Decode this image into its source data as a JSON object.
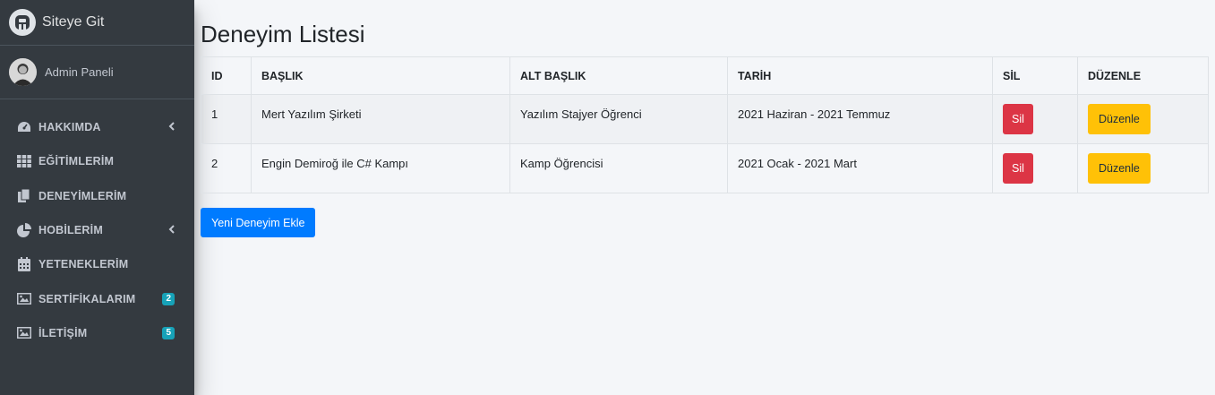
{
  "brand": {
    "name": "Siteye Git",
    "icon": "logo-icon"
  },
  "user": {
    "name": "Admin Paneli"
  },
  "sidebar": {
    "items": [
      {
        "label": "HAKKIMDA",
        "icon": "dashboard-icon",
        "chevron": true
      },
      {
        "label": "EĞİTİMLERİM",
        "icon": "grid-icon",
        "chevron": false
      },
      {
        "label": "DENEYİMLERİM",
        "icon": "copy-icon",
        "chevron": false
      },
      {
        "label": "HOBİLERİM",
        "icon": "pie-chart-icon",
        "chevron": true
      },
      {
        "label": "YETENEKLERİM",
        "icon": "calendar-icon",
        "chevron": false
      },
      {
        "label": "SERTİFİKALARIM",
        "icon": "image-icon",
        "badge": "2"
      },
      {
        "label": "İLETİŞİM",
        "icon": "image-icon",
        "badge": "5"
      }
    ]
  },
  "main": {
    "title": "Deneyim Listesi",
    "table": {
      "headers": [
        "ID",
        "BAŞLIK",
        "ALT BAŞLIK",
        "TARİH",
        "SİL",
        "DÜZENLE"
      ],
      "rows": [
        {
          "id": "1",
          "baslik": "Mert Yazılım Şirketi",
          "alt_baslik": "Yazılım Stajyer Öğrenci",
          "tarih": "2021 Haziran - 2021 Temmuz",
          "sil": "Sil",
          "duzenle": "Düzenle"
        },
        {
          "id": "2",
          "baslik": "Engin Demiroğ ile C# Kampı",
          "alt_baslik": "Kamp Öğrencisi",
          "tarih": "2021 Ocak - 2021 Mart",
          "sil": "Sil",
          "duzenle": "Düzenle"
        }
      ]
    },
    "add_button": "Yeni Deneyim Ekle"
  },
  "colors": {
    "sidebar_bg": "#343a40",
    "danger": "#dc3545",
    "warning": "#ffc107",
    "primary": "#007bff",
    "badge": "#17a2b8"
  }
}
